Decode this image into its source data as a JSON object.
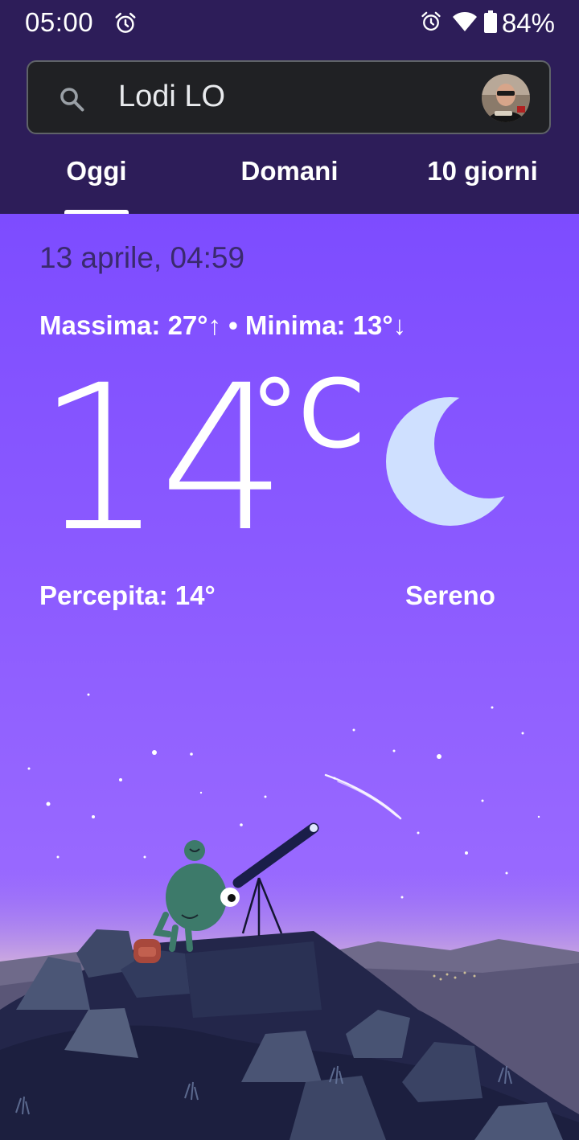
{
  "status_bar": {
    "time": "05:00",
    "battery": "84%",
    "icons": [
      "alarm-icon",
      "alarm-icon",
      "wifi-icon",
      "battery-icon"
    ]
  },
  "search": {
    "query": "Lodi LO",
    "icon": "search-icon"
  },
  "tabs": [
    {
      "label": "Oggi",
      "selected": true
    },
    {
      "label": "Domani",
      "selected": false
    },
    {
      "label": "10 giorni",
      "selected": false
    }
  ],
  "weather": {
    "date_time": "13 aprile, 04:59",
    "minmax": "Massima: 27°↑ • Minima: 13°↓",
    "temperature": "14",
    "unit": "°C",
    "feels_like": "Percepita: 14°",
    "condition": "Sereno",
    "condition_icon": "moon-icon"
  },
  "colors": {
    "header_bg": "#2d1d59",
    "sky_top": "#7d4cff",
    "search_bg": "#202124"
  }
}
